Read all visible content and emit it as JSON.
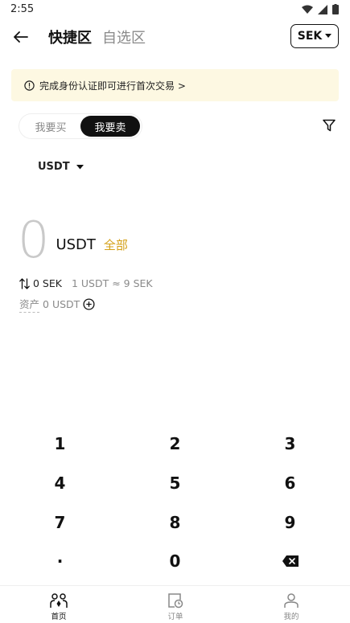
{
  "status_bar": {
    "time": "2:55"
  },
  "header": {
    "tabs": [
      {
        "label": "快捷区",
        "active": true
      },
      {
        "label": "自选区",
        "active": false
      }
    ],
    "currency": "SEK"
  },
  "notice": {
    "text": "完成身份认证即可进行首次交易 >"
  },
  "trade_toggle": {
    "options": [
      {
        "label": "我要买",
        "active": false
      },
      {
        "label": "我要卖",
        "active": true
      }
    ]
  },
  "coin_selector": {
    "value": "USDT"
  },
  "amount": {
    "value": "0",
    "unit": "USDT",
    "all_label": "全部"
  },
  "conversion": {
    "fiat_amount": "0 SEK",
    "rate": "1 USDT ≈ 9 SEK"
  },
  "assets": {
    "label": "资产",
    "value": "0 USDT"
  },
  "keypad": {
    "keys": [
      "1",
      "2",
      "3",
      "4",
      "5",
      "6",
      "7",
      "8",
      "9",
      "·",
      "0"
    ]
  },
  "bottom_nav": {
    "items": [
      {
        "label": "首页",
        "icon": "people-icon",
        "active": true
      },
      {
        "label": "订单",
        "icon": "order-clock-icon",
        "active": false
      },
      {
        "label": "我的",
        "icon": "person-icon",
        "active": false
      }
    ]
  },
  "colors": {
    "accent": "#d4a017",
    "notice_bg": "#fdf8e2",
    "primary": "#111111"
  }
}
